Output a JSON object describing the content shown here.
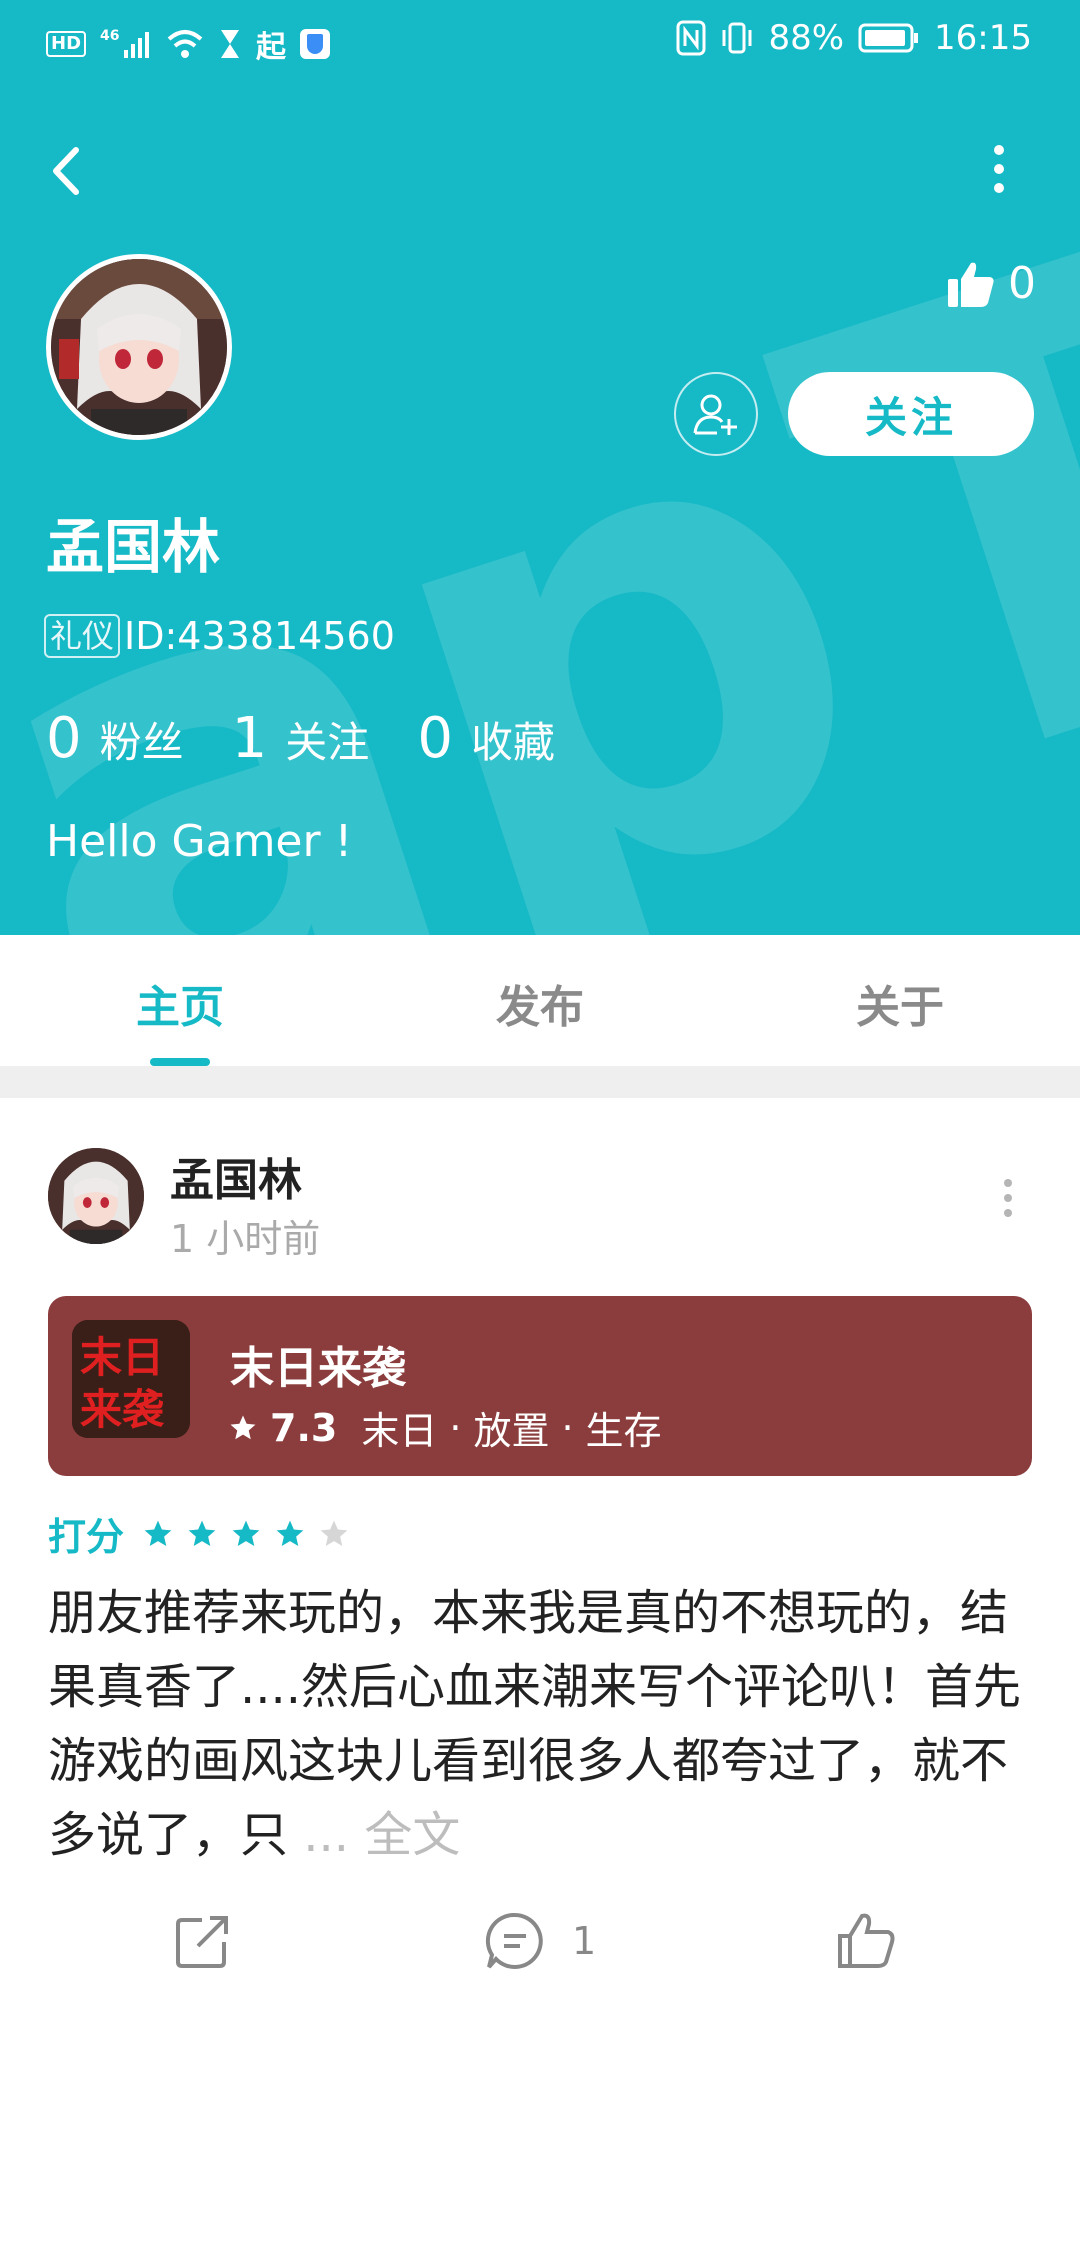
{
  "status_bar": {
    "left_chips": [
      "HD",
      "46"
    ],
    "app_icon_char": "起",
    "battery": "88%",
    "time": "16:15"
  },
  "header": {
    "watermark_text": "apTa",
    "likes_count": "0",
    "follow_label": "关注"
  },
  "profile": {
    "name": "孟国林",
    "tag": "礼仪",
    "id_text": "ID:433814560",
    "stats": [
      {
        "num": "0",
        "label": "粉丝"
      },
      {
        "num": "1",
        "label": "关注"
      },
      {
        "num": "0",
        "label": "收藏"
      }
    ],
    "bio": "Hello Gamer !"
  },
  "tabs": [
    {
      "label": "主页",
      "active": true
    },
    {
      "label": "发布",
      "active": false
    },
    {
      "label": "关于",
      "active": false
    }
  ],
  "post": {
    "author": "孟国林",
    "time": "1 小时前",
    "game": {
      "name": "末日来袭",
      "score": "7.3",
      "tags": [
        "末日",
        "放置",
        "生存"
      ],
      "icon_text_top": "末日",
      "icon_text_bottom": "来袭"
    },
    "rating_label": "打分",
    "rating_value": 4,
    "rating_max": 5,
    "text": "朋友推荐来玩的，本来我是真的不想玩的，结果真香了....然后心血来潮来写个评论叭！首先游戏的画风这块儿看到很多人都夸过了，就不多说了，只",
    "ellipsis": "...",
    "full_label": "全文",
    "comment_count": "1"
  },
  "colors": {
    "accent": "#16b9c6",
    "game_card": "#8b3c3c",
    "star_off": "#d6d6d6"
  }
}
